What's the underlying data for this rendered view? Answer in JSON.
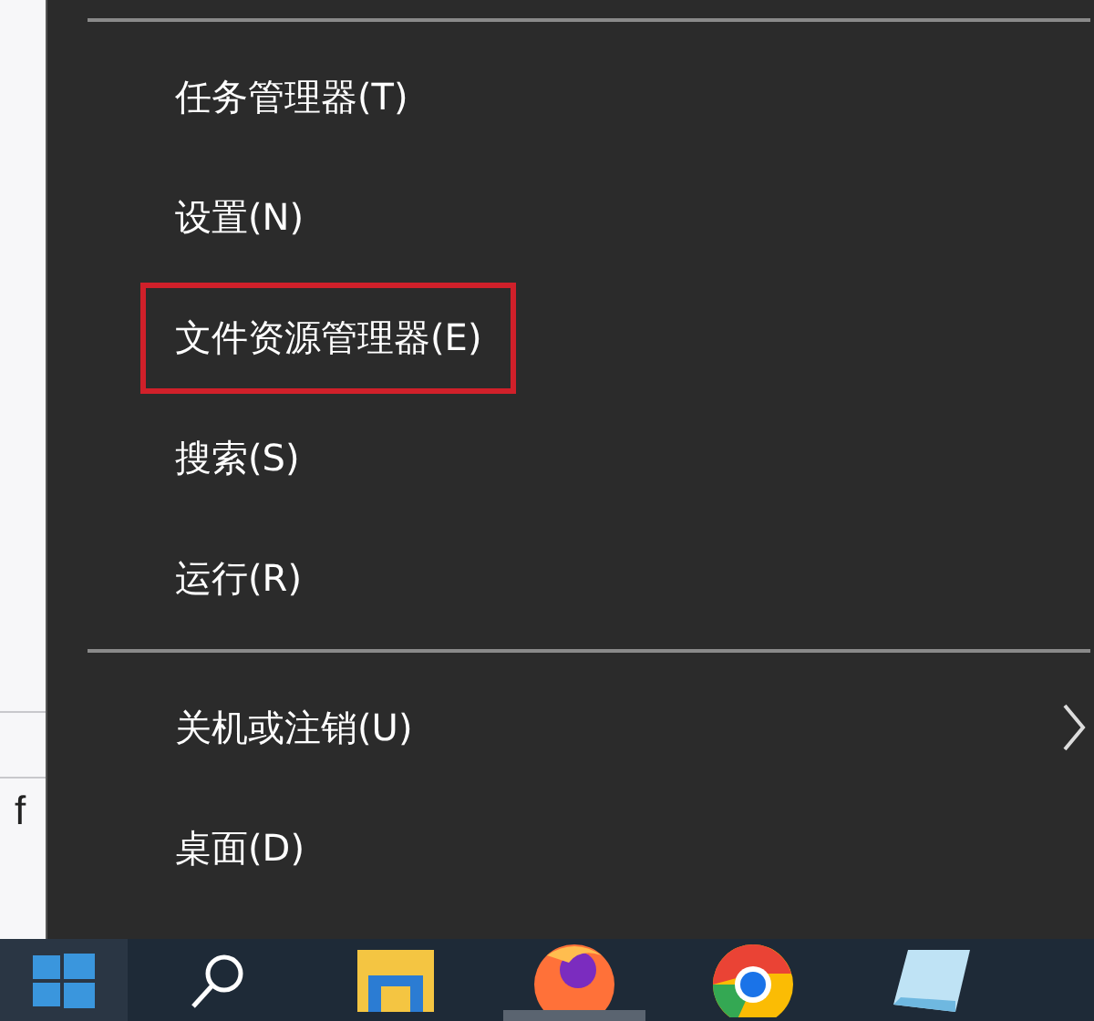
{
  "background_window": {
    "text": "f"
  },
  "menu": {
    "groups": [
      {
        "items": [
          {
            "label": "任务管理器(T)",
            "highlighted": false,
            "submenu": false
          },
          {
            "label": "设置(N)",
            "highlighted": false,
            "submenu": false
          },
          {
            "label": "文件资源管理器(E)",
            "highlighted": true,
            "submenu": false
          },
          {
            "label": "搜索(S)",
            "highlighted": false,
            "submenu": false
          },
          {
            "label": "运行(R)",
            "highlighted": false,
            "submenu": false
          }
        ]
      },
      {
        "items": [
          {
            "label": "关机或注销(U)",
            "highlighted": false,
            "submenu": true
          },
          {
            "label": "桌面(D)",
            "highlighted": false,
            "submenu": false
          }
        ]
      }
    ]
  },
  "taskbar": {
    "items": [
      {
        "kind": "start",
        "selected": false
      },
      {
        "kind": "search",
        "selected": false
      },
      {
        "kind": "folder",
        "selected": false
      },
      {
        "kind": "firefox",
        "selected": true
      },
      {
        "kind": "chrome",
        "selected": false
      },
      {
        "kind": "notepad",
        "selected": false
      }
    ]
  }
}
